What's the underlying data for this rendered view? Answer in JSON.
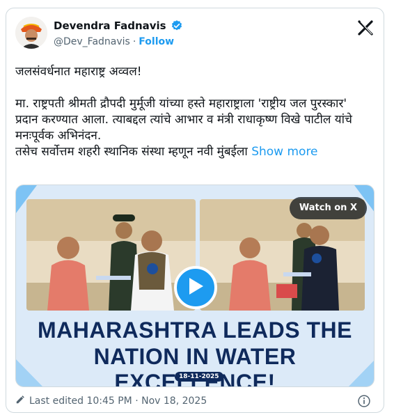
{
  "author": {
    "name": "Devendra Fadnavis",
    "handle": "@Dev_Fadnavis",
    "separator": "·",
    "follow_label": "Follow"
  },
  "tweet": {
    "line1": "जलसंवर्धनात महाराष्ट्र अव्वल!",
    "body": "मा. राष्ट्रपती श्रीमती द्रौपदी मुर्मूजी यांच्या हस्ते महाराष्ट्राला 'राष्ट्रीय जल पुरस्कार' प्रदान करण्यात आला. त्याबद्दल त्यांचे आभार व मंत्री राधाकृष्ण विखे पाटील यांचे मनःपूर्वक अभिनंदन.\nतसेच सर्वोत्तम शहरी स्थानिक संस्था म्हणून नवी मुंबईला ",
    "show_more": "Show more"
  },
  "media": {
    "watch_label": "Watch on X",
    "headline_line1": "MAHARASHTRA LEADS THE",
    "headline_line2": "NATION IN WATER EXCELLENCE!",
    "date": "18-11-2025",
    "accent": "#1d9bf0",
    "headline_color": "#0f2a5c"
  },
  "footer": {
    "edited_text": "Last edited 10:45 PM · Nov 18, 2025"
  },
  "icons": [
    "verified-badge-icon",
    "x-logo-icon",
    "play-icon",
    "pencil-icon",
    "info-icon"
  ]
}
